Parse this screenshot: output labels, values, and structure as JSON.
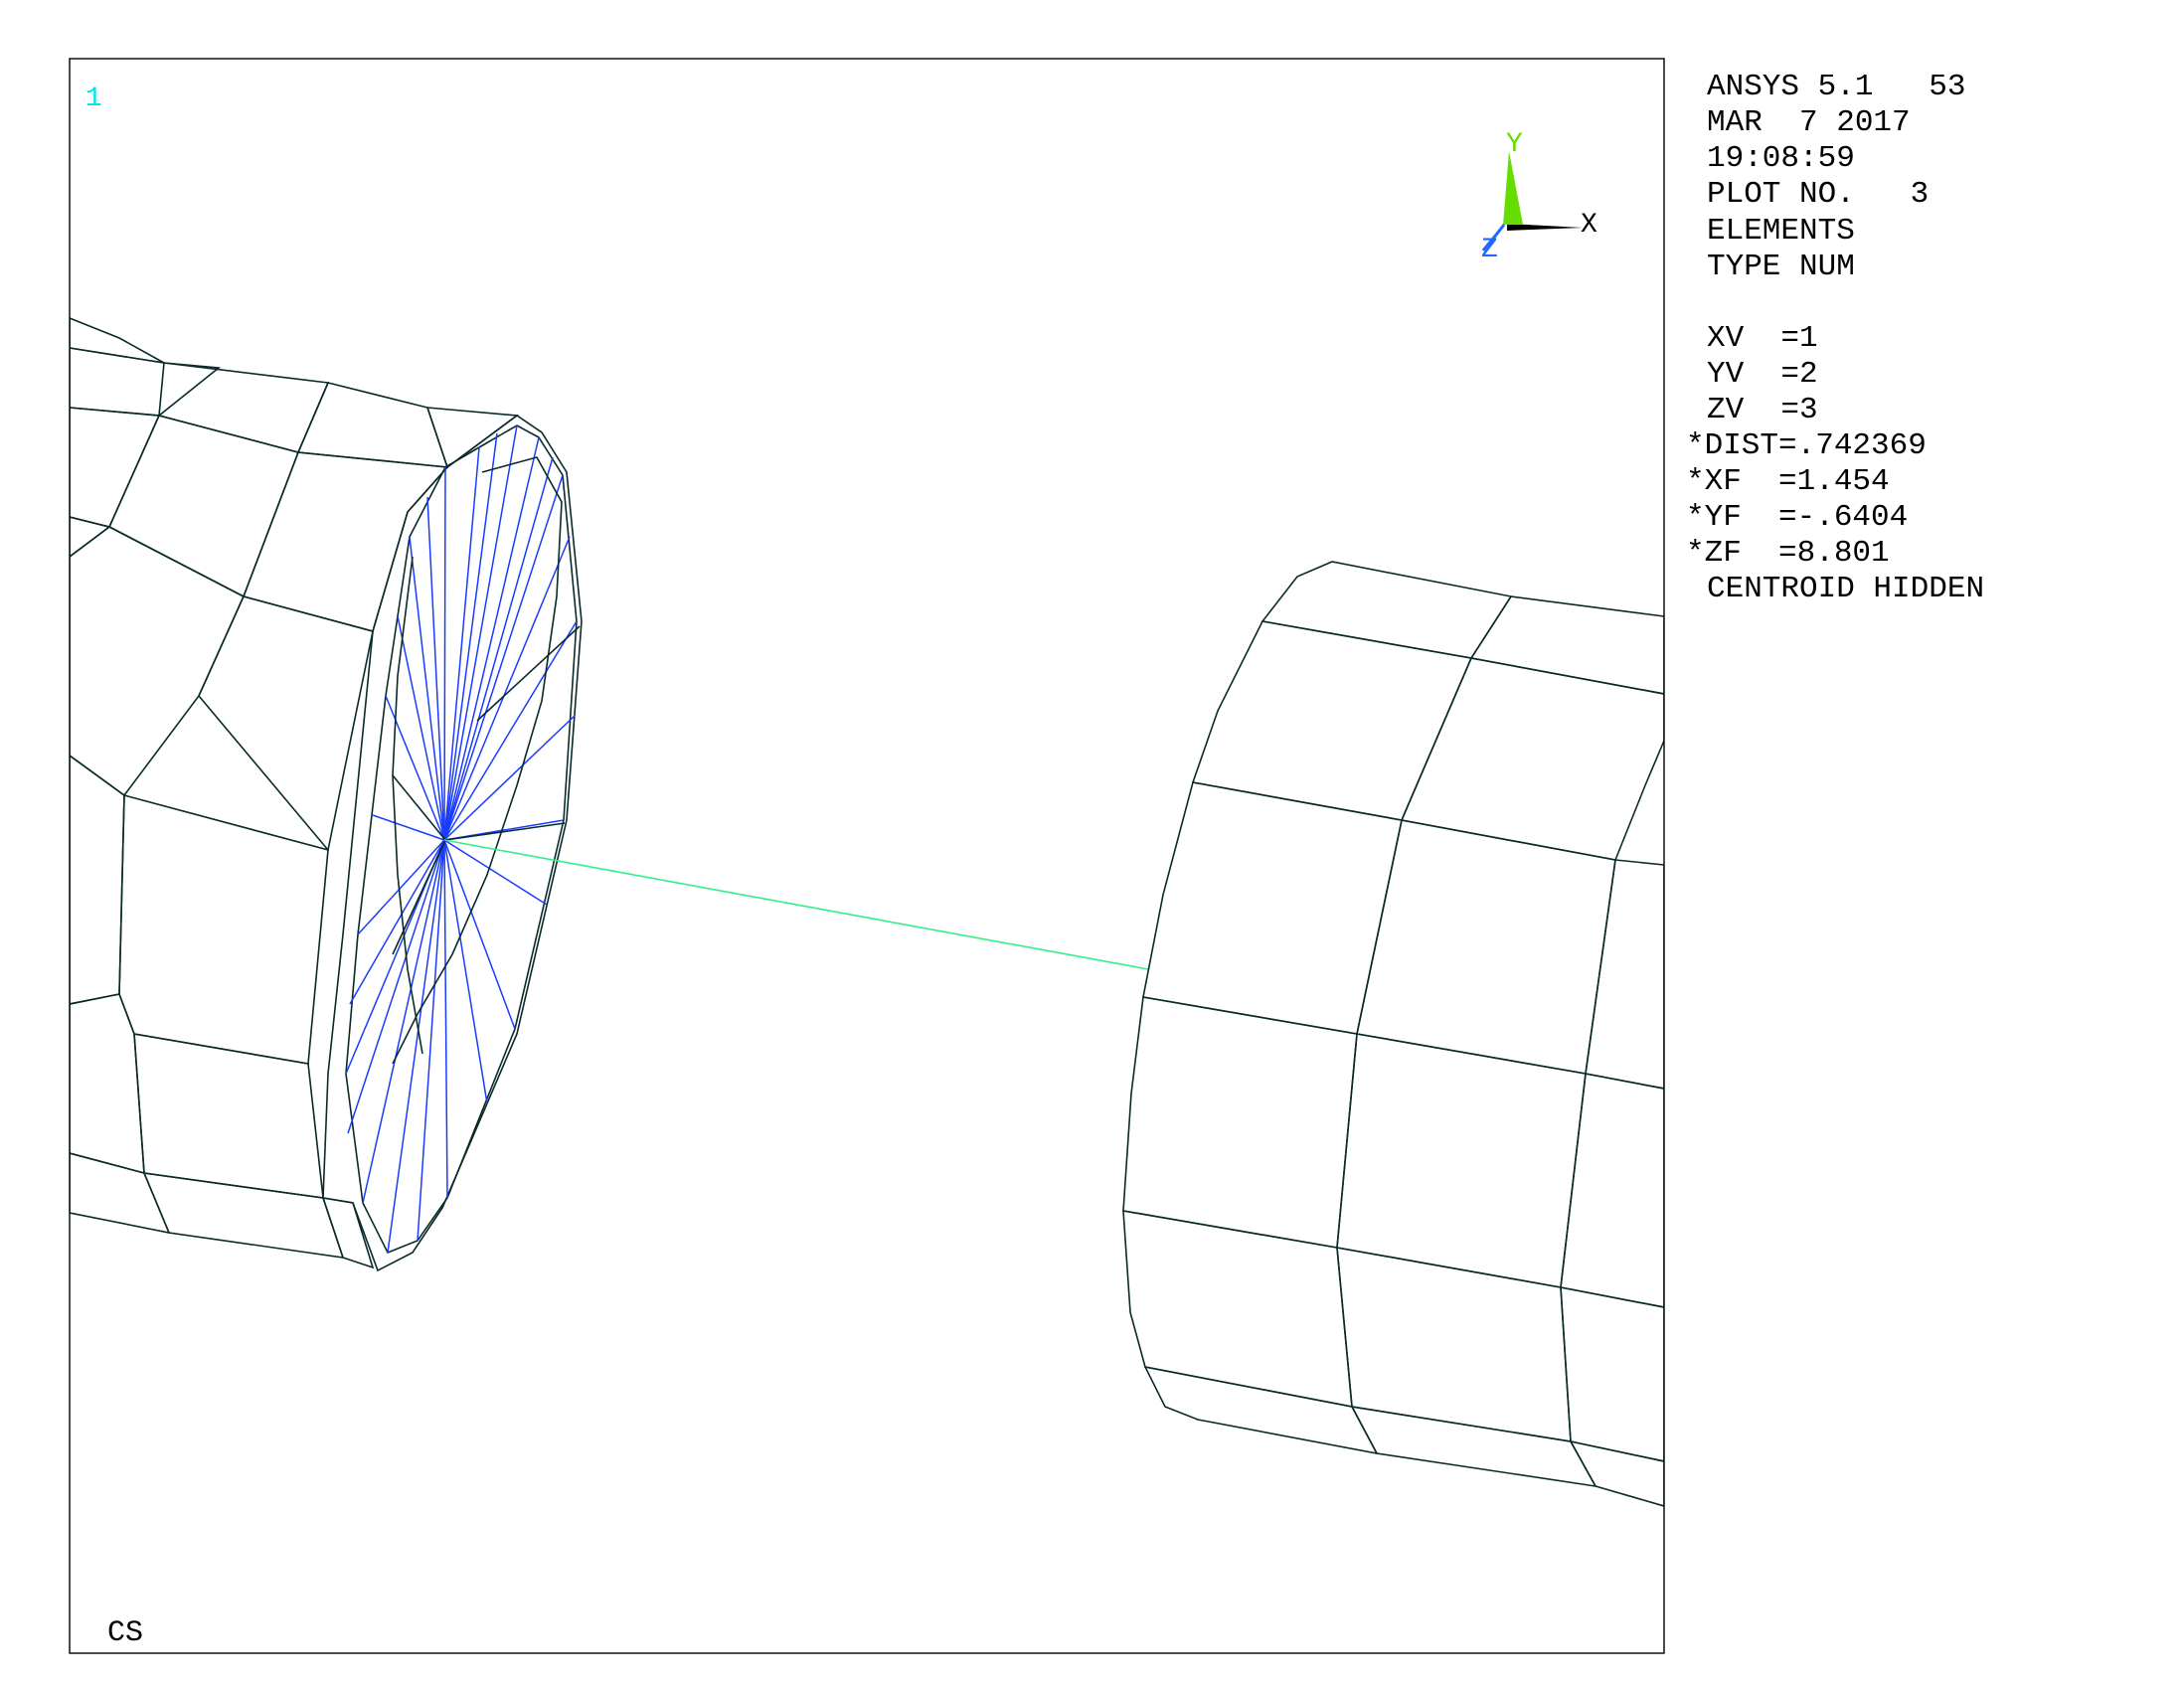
{
  "window": {
    "number": "1",
    "cs_label": "CS"
  },
  "info_panel": {
    "lines": [
      "ANSYS 5.1   53",
      "MAR  7 2017",
      "19:08:59",
      "PLOT NO.   3",
      "ELEMENTS",
      "TYPE NUM",
      "",
      "XV  =1",
      "YV  =2",
      "ZV  =3",
      "*DIST=.742369",
      "*XF  =1.454",
      "*YF  =-.6404",
      "*ZF  =8.801",
      "CENTROID HIDDEN"
    ]
  },
  "triad": {
    "x_label": "X",
    "y_label": "Y",
    "z_label": "Z"
  },
  "colors": {
    "bright": "#00f2f2",
    "medium": "#00d6d6",
    "dark": "#00a0a0",
    "darker": "#009898",
    "spokes": "#1a3cff",
    "link": "#33ee88",
    "axis_y": "#66dd00",
    "axis_z": "#2266ff"
  }
}
